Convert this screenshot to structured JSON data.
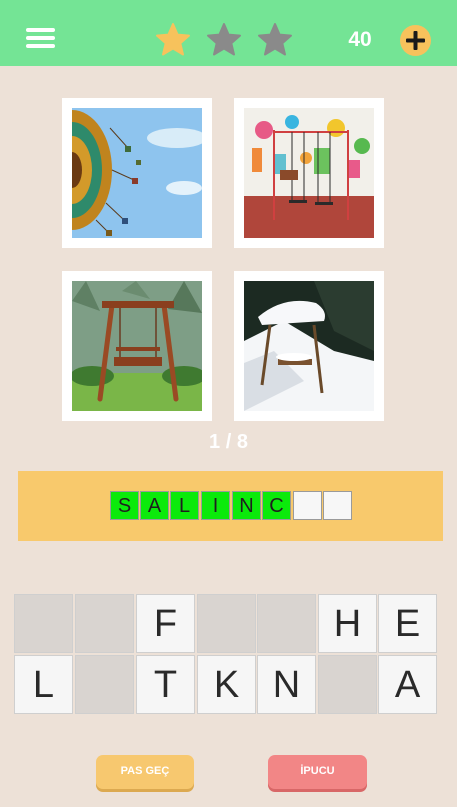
{
  "header": {
    "coins": "40",
    "stars": [
      {
        "name": "star-1",
        "filled": true
      },
      {
        "name": "star-2",
        "filled": false
      },
      {
        "name": "star-3",
        "filled": false
      }
    ],
    "colors": {
      "bar": "#74e495",
      "star_on": "#f7c25c",
      "star_off": "#8a8a8a"
    }
  },
  "progress": "1 / 8",
  "answer": {
    "slots": [
      "S",
      "A",
      "L",
      "I",
      "N",
      "C",
      "",
      ""
    ],
    "filled_color": "#0bea0b"
  },
  "letters": {
    "row1": [
      "",
      "",
      "F",
      "",
      "",
      "H",
      "E"
    ],
    "row2": [
      "L",
      "",
      "T",
      "K",
      "N",
      "",
      "A"
    ]
  },
  "buttons": {
    "skip_label": "PAS GEÇ",
    "hint_label": "İPUCU"
  }
}
